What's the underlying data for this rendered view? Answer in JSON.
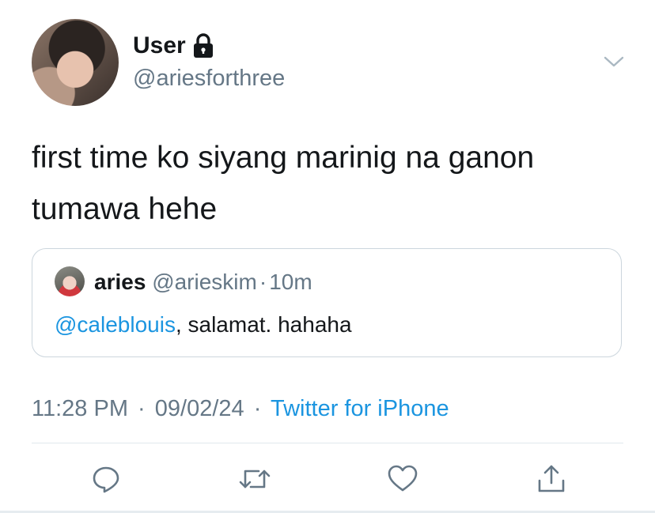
{
  "tweet": {
    "author_name": "User",
    "author_handle": "@ariesforthree",
    "text": "first time ko siyang marinig na ganon tumawa hehe",
    "quoted": {
      "name": "aries",
      "handle": "@arieskim",
      "separator": "·",
      "time_ago": "10m",
      "mention": "@caleblouis",
      "text_rest": ", salamat. hahaha"
    },
    "time": "11:28 PM",
    "date": "09/02/24",
    "separator": "·",
    "source": "Twitter for iPhone"
  },
  "icons": {
    "lock": "lock-icon",
    "more": "chevron-down-icon",
    "reply": "reply-icon",
    "retweet": "retweet-icon",
    "like": "heart-icon",
    "share": "share-icon"
  },
  "colors": {
    "link": "#1b95e0",
    "secondary_text": "#657786",
    "primary_text": "#14171a",
    "border": "#ccd6dd"
  }
}
